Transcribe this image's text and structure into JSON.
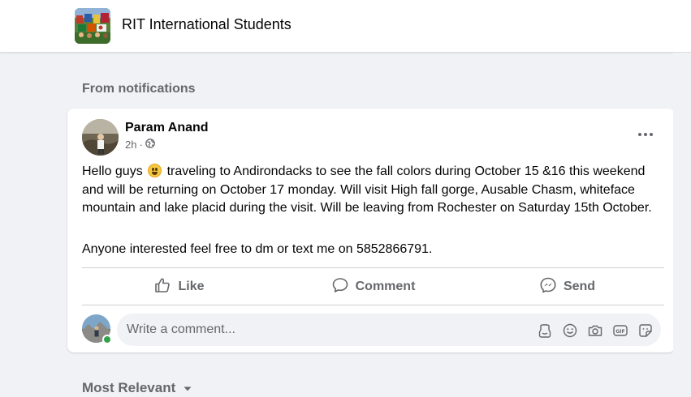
{
  "group": {
    "title": "RIT International Students"
  },
  "section": {
    "label": "From notifications"
  },
  "post": {
    "author": "Param Anand",
    "time": "2h",
    "privacy_separator": "·",
    "text_before_emoji": "Hello guys ",
    "text_after_emoji": " traveling to Andirondacks to see the fall colors during October 15 &16 this weekend and will be returning on October 17 monday. Will visit High fall gorge, Ausable Chasm, whiteface mountain and lake placid during the visit. Will be leaving from Rochester on Saturday 15th October.",
    "text_second": "Anyone interested feel free to dm or text me on 5852866791."
  },
  "actions": {
    "like": "Like",
    "comment": "Comment",
    "send": "Send"
  },
  "comment": {
    "placeholder": "Write a comment..."
  },
  "sort": {
    "label": "Most Relevant"
  },
  "icons": {
    "like": "thumbs-up-icon",
    "comment": "speech-bubble-icon",
    "send": "messenger-icon",
    "privacy": "globe-icon",
    "more": "more-dots-icon",
    "avatar_sticker": "avatar-sticker-icon",
    "emoji": "smiley-icon",
    "camera": "camera-icon",
    "gif": "gif-icon",
    "sticker": "sticker-icon",
    "sort": "caret-down-icon"
  },
  "colors": {
    "background": "#f0f2f5",
    "text": "#050505",
    "secondary": "#65676b",
    "online": "#31a24c"
  }
}
